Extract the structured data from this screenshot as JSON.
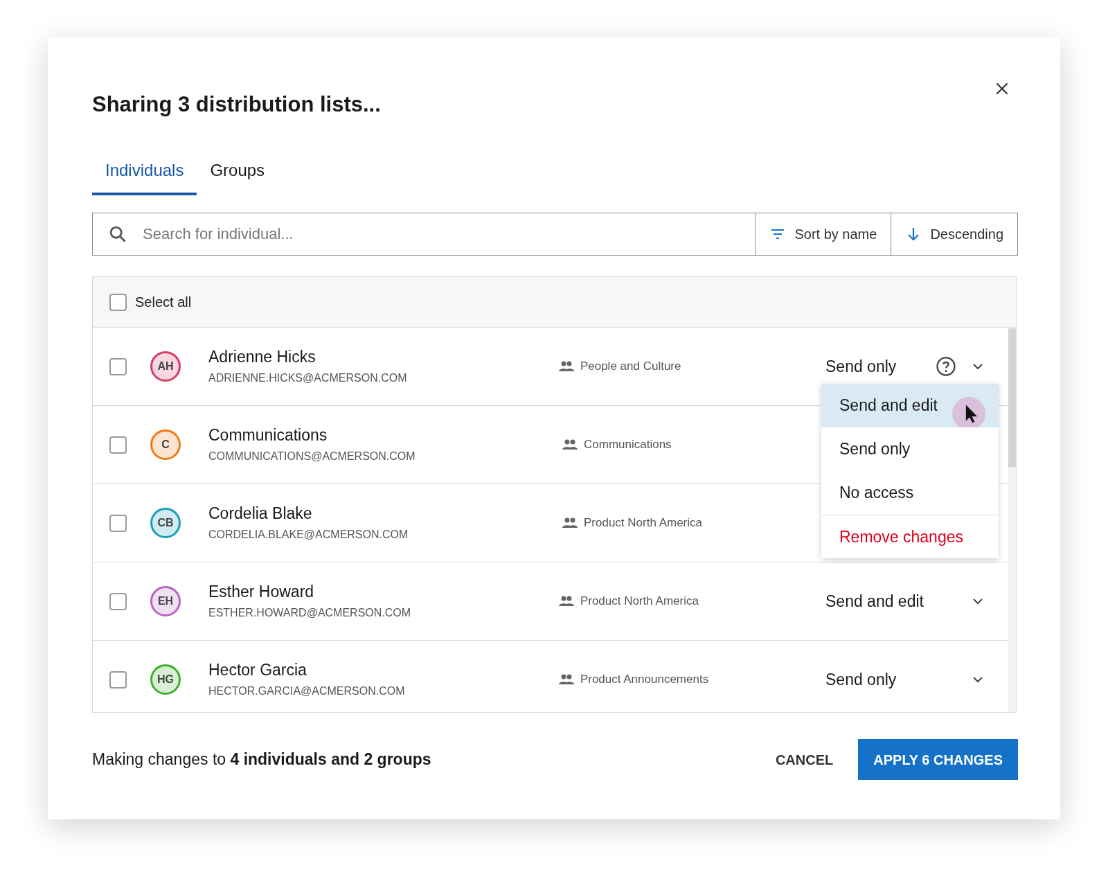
{
  "dialog": {
    "title": "Sharing 3 distribution lists..."
  },
  "tabs": [
    {
      "label": "Individuals",
      "selected": true
    },
    {
      "label": "Groups",
      "selected": false
    }
  ],
  "search": {
    "placeholder": "Search for individual..."
  },
  "sort": {
    "label": "Sort by name"
  },
  "order": {
    "label": "Descending"
  },
  "select_all": {
    "label": "Select all",
    "checked": false
  },
  "rows": [
    {
      "initials": "AH",
      "name": "Adrienne Hicks",
      "email": "ADRIENNE.HICKS@ACMERSON.COM",
      "group": "People and Culture",
      "color": "#d63a63",
      "checked": false,
      "access": "Send only",
      "help": true
    },
    {
      "initials": "C",
      "name": "Communications",
      "email": "COMMUNICATIONS@ACMERSON.COM",
      "group": "Communications",
      "color": "#f07a16",
      "checked": false
    },
    {
      "initials": "CB",
      "name": "Cordelia Blake",
      "email": "CORDELIA.BLAKE@ACMERSON.COM",
      "group": "Product North America",
      "color": "#1aa0b5",
      "checked": false
    },
    {
      "initials": "EH",
      "name": "Esther Howard",
      "email": "ESTHER.HOWARD@ACMERSON.COM",
      "group": "Product North America",
      "color": "#b766c0",
      "checked": false,
      "access": "Send and edit",
      "help": false
    },
    {
      "initials": "HG",
      "name": "Hector Garcia",
      "email": "HECTOR.GARCIA@ACMERSON.COM",
      "group": "Product Announcements",
      "color": "#3eae2b",
      "checked": false,
      "access": "Send only",
      "help": false
    }
  ],
  "dropdown": {
    "items": [
      {
        "label": "Send and edit",
        "selected": true,
        "kind": "option"
      },
      {
        "label": "Send only",
        "selected": false,
        "kind": "option"
      },
      {
        "label": "No access",
        "selected": false,
        "kind": "option"
      },
      {
        "label": "Remove changes",
        "selected": false,
        "kind": "danger"
      }
    ]
  },
  "footer": {
    "summary": "Making changes to **4 individuals and 2 groups**",
    "cancel": "CANCEL",
    "apply": "APPLY 6 CHANGES"
  }
}
